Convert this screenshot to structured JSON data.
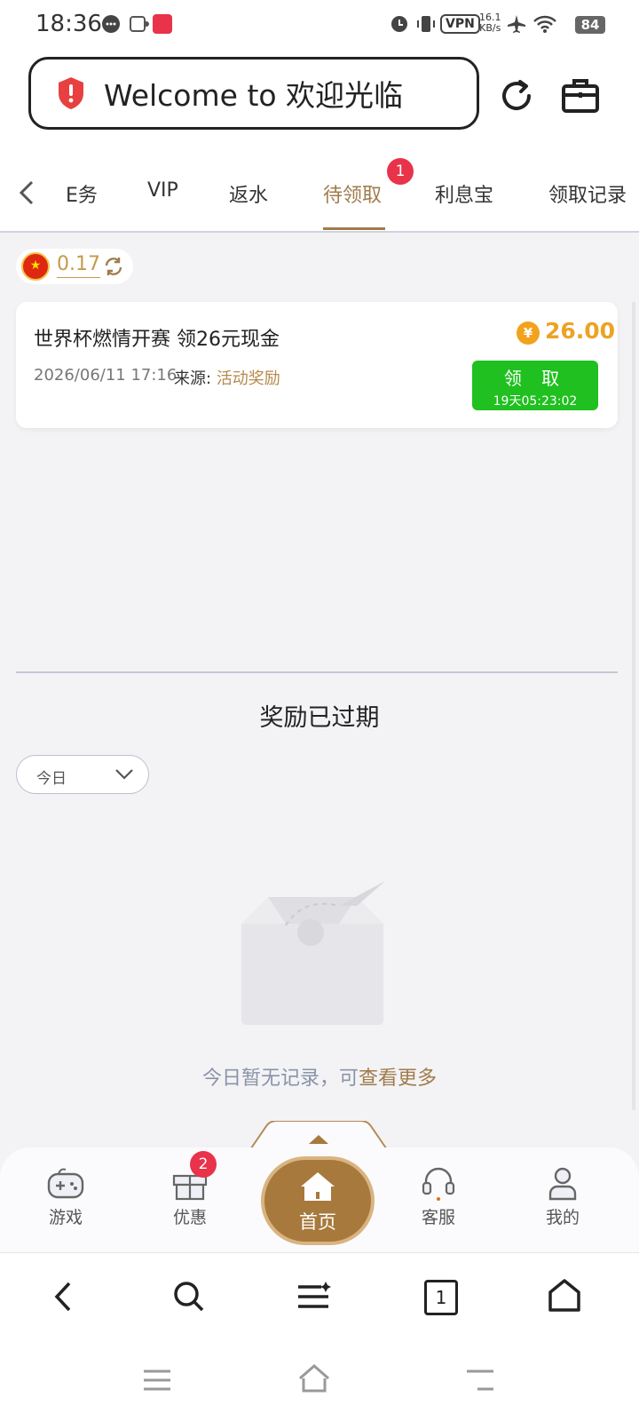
{
  "status_bar": {
    "time": "18:36",
    "vpn": "VPN",
    "speed_value": "16.1",
    "speed_unit": "KB/s",
    "battery": "84"
  },
  "header": {
    "welcome_text": "Welcome to 欢迎光临"
  },
  "tabs": {
    "items": [
      {
        "label": "E务"
      },
      {
        "label": "VIP"
      },
      {
        "label": "返水"
      },
      {
        "label": "待领取",
        "active": true,
        "badge": "1"
      },
      {
        "label": "利息宝"
      },
      {
        "label": "领取记录"
      }
    ]
  },
  "balance": {
    "flag": "★",
    "amount": "0.17"
  },
  "reward_card": {
    "title": "世界杯燃情开赛 领26元现金",
    "datetime": "2026/06/11 17:16",
    "source_label": "来源:",
    "source_value": "活动奖励",
    "coin_symbol": "¥",
    "amount": "26.00",
    "claim_label": "领 取",
    "countdown": "19天05:23:02"
  },
  "expired": {
    "title": "奖励已过期",
    "filter_value": "今日",
    "empty_prefix": "今日暂无记录，可",
    "empty_link": "查看更多"
  },
  "bottom_nav": {
    "games": "游戏",
    "promos": "优惠",
    "promos_badge": "2",
    "home": "首页",
    "service": "客服",
    "mine": "我的"
  },
  "browser_bar": {
    "tab_count": "1"
  },
  "colors": {
    "accent_gold": "#a07b4b",
    "claim_green": "#1fc01f",
    "badge_red": "#e8334a",
    "amount_orange": "#eca324"
  }
}
